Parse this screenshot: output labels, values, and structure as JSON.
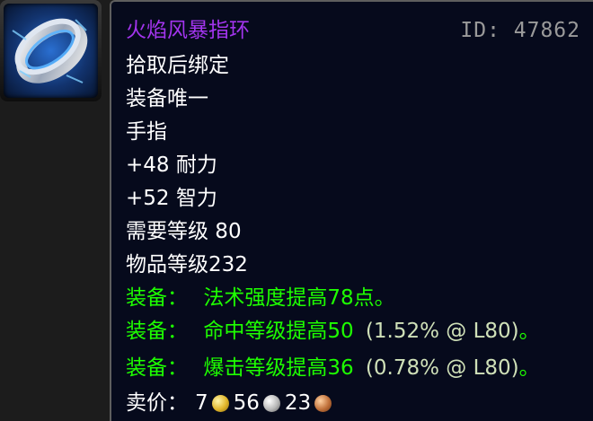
{
  "item": {
    "name": "火焰风暴指环",
    "id_label": "ID: 47862",
    "binding": "拾取后绑定",
    "unique": "装备唯一",
    "slot": "手指",
    "stats": [
      "+48 耐力",
      "+52 智力"
    ],
    "required_level": "需要等级 80",
    "item_level": "物品等级232",
    "effects": [
      {
        "prefix": "装备：",
        "text": "法术强度提高78点。",
        "detail": ""
      },
      {
        "prefix": "装备：",
        "text": "命中等级提高50",
        "detail": "(1.52% @ L80)",
        "suffix": "。"
      },
      {
        "prefix": "装备：",
        "text": "爆击等级提高36",
        "detail": "(0.78% @ L80)",
        "suffix": "。"
      }
    ],
    "sell": {
      "label": "卖价：",
      "gold": "7",
      "silver": "56",
      "copper": "23"
    }
  },
  "colors": {
    "epic": "#a335ee",
    "green": "#1eff00",
    "background": "#060a1c"
  },
  "icon": "ring-icon"
}
